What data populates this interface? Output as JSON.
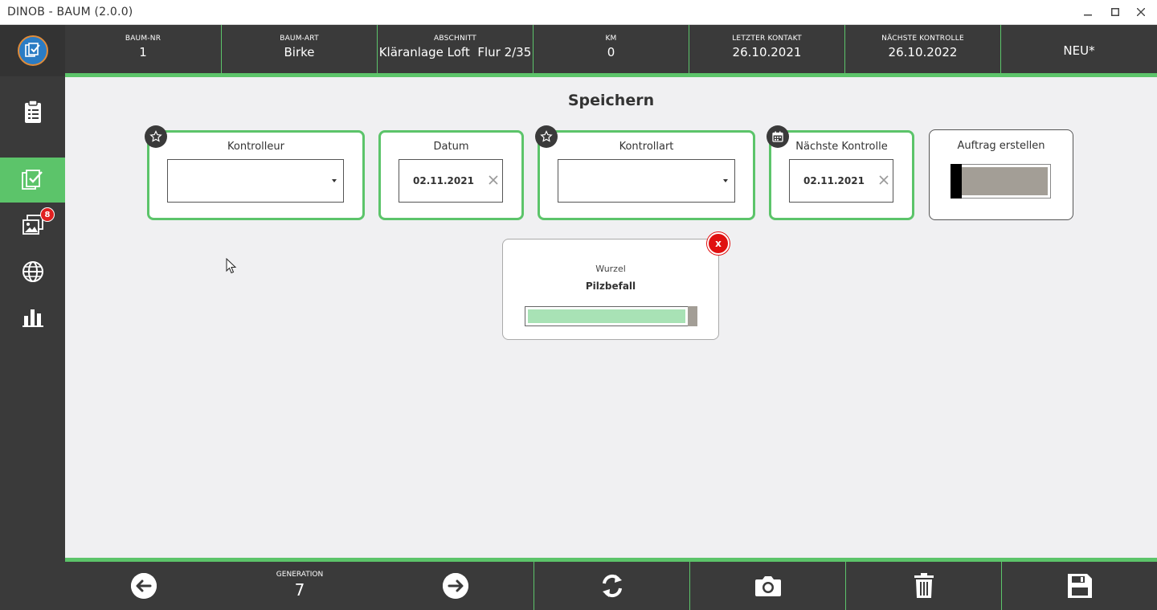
{
  "window": {
    "title": "DINOB - BAUM (2.0.0)"
  },
  "sidebar": {
    "items": [
      {
        "name": "clipboard",
        "active": false
      },
      {
        "name": "checklist",
        "active": true
      },
      {
        "name": "gallery",
        "active": false,
        "badge": "8"
      },
      {
        "name": "globe",
        "active": false
      },
      {
        "name": "chart",
        "active": false
      }
    ]
  },
  "header": {
    "baum_nr": {
      "label": "BAUM-NR",
      "value": "1"
    },
    "baum_art": {
      "label": "BAUM-ART",
      "value": "Birke"
    },
    "abschnitt": {
      "label": "ABSCHNITT",
      "value": "Kläranlage Loft  Flur 2/35"
    },
    "km": {
      "label": "KM",
      "value": "0"
    },
    "letzter_kontakt": {
      "label": "LETZTER KONTAKT",
      "value": "26.10.2021"
    },
    "naechste_kontrolle": {
      "label": "NÄCHSTE KONTROLLE",
      "value": "26.10.2022"
    },
    "status": {
      "value": "NEU*"
    }
  },
  "main": {
    "title": "Speichern",
    "kontrolleur": {
      "label": "Kontrolleur",
      "value": ""
    },
    "datum": {
      "label": "Datum",
      "value": "02.11.2021"
    },
    "kontrollart": {
      "label": "Kontrollart",
      "value": ""
    },
    "naechste_kontrolle": {
      "label": "Nächste Kontrolle",
      "value": "02.11.2021"
    },
    "auftrag": {
      "label": "Auftrag erstellen",
      "checked": false
    },
    "finding": {
      "category": "Wurzel",
      "name": "Pilzbefall",
      "close_label": "x",
      "active": true
    }
  },
  "footer": {
    "generation": {
      "label": "GENERATION",
      "value": "7"
    }
  },
  "colors": {
    "accent": "#5cc46a",
    "dark": "#3a3a3a",
    "danger": "#e01010"
  }
}
